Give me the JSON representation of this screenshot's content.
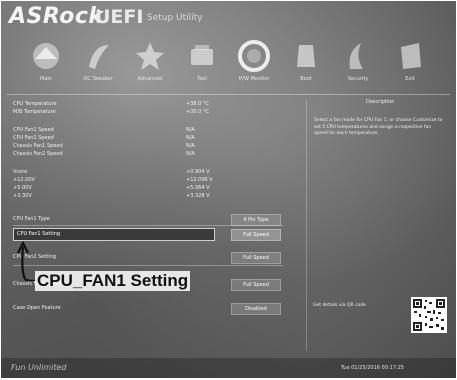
{
  "header": {
    "brand": "ASRock",
    "uefi": "UEFI",
    "subtitle": "Setup Utility"
  },
  "nav": {
    "tabs": [
      {
        "label": "Main",
        "icon": "main-icon"
      },
      {
        "label": "OC Tweaker",
        "icon": "oc-tweaker-icon"
      },
      {
        "label": "Advanced",
        "icon": "advanced-icon"
      },
      {
        "label": "Tool",
        "icon": "tool-icon"
      },
      {
        "label": "H/W Monitor",
        "icon": "hw-monitor-icon"
      },
      {
        "label": "Boot",
        "icon": "boot-icon"
      },
      {
        "label": "Security",
        "icon": "security-icon"
      },
      {
        "label": "Exit",
        "icon": "exit-icon"
      }
    ]
  },
  "monitor": {
    "temps": [
      {
        "label": "CPU Temperature",
        "value": "+38.0 °C"
      },
      {
        "label": "M/B Temperature",
        "value": "+30.0 °C"
      }
    ],
    "fans": [
      {
        "label": "CPU Fan1 Speed",
        "value": "N/A"
      },
      {
        "label": "CPU Fan2 Speed",
        "value": "N/A"
      },
      {
        "label": "Chassis Fan1 Speed",
        "value": "N/A"
      },
      {
        "label": "Chassis Fan2 Speed",
        "value": "N/A"
      }
    ],
    "voltages": [
      {
        "label": "Vcore",
        "value": "+0.904 V"
      },
      {
        "label": "+12.00V",
        "value": "+12.096 V"
      },
      {
        "label": "+5.00V",
        "value": "+5.064 V"
      },
      {
        "label": "+3.30V",
        "value": "+3.328 V"
      }
    ],
    "settings": [
      {
        "label": "CPU Fan1 Type",
        "value": "4 Pin Type"
      },
      {
        "label": "CPU Fan1 Setting",
        "value": "Full Speed"
      },
      {
        "label": "CPU Fan2 Setting",
        "value": "Full Speed"
      },
      {
        "label": "Chassis Fan1 Setting",
        "value": "Full Speed"
      },
      {
        "label": "Case Open Feature",
        "value": "Disabled"
      }
    ]
  },
  "description": {
    "title": "Description",
    "text": "Select a fan mode for CPU Fan 1, or choose Customize to set 5 CPU temperatures and assign a respective fan speed for each temperature."
  },
  "qr": {
    "label": "Get details via QR code"
  },
  "footer": {
    "logo": "Fun Unlimited",
    "datetime": "Tue 01/25/2016  00:17:25"
  },
  "callout": {
    "text": "CPU_FAN1 Setting"
  }
}
